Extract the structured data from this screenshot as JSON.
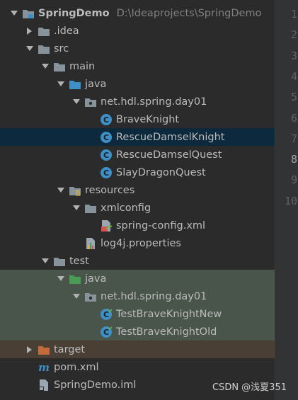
{
  "project": {
    "name": "SpringDemo",
    "path": "D:\\Ideaprojects\\SpringDemo"
  },
  "tree": [
    {
      "label": "SpringDemo",
      "icon": "project-folder-icon",
      "depth": 0,
      "expanded": true
    },
    {
      "label": ".idea",
      "icon": "folder-icon",
      "depth": 1,
      "expanded": false
    },
    {
      "label": "src",
      "icon": "folder-icon",
      "depth": 1,
      "expanded": true
    },
    {
      "label": "main",
      "icon": "folder-icon",
      "depth": 2,
      "expanded": true
    },
    {
      "label": "java",
      "icon": "source-root-folder-icon",
      "depth": 3,
      "expanded": true
    },
    {
      "label": "net.hdl.spring.day01",
      "icon": "package-icon",
      "depth": 4,
      "expanded": true
    },
    {
      "label": "BraveKnight",
      "icon": "class-icon",
      "depth": 5
    },
    {
      "label": "RescueDamselKnight",
      "icon": "class-icon",
      "depth": 5,
      "selected": true
    },
    {
      "label": "RescueDamselQuest",
      "icon": "class-icon",
      "depth": 5
    },
    {
      "label": "SlayDragonQuest",
      "icon": "class-icon",
      "depth": 5
    },
    {
      "label": "resources",
      "icon": "resources-folder-icon",
      "depth": 3,
      "expanded": true
    },
    {
      "label": "xmlconfig",
      "icon": "folder-icon",
      "depth": 4,
      "expanded": true
    },
    {
      "label": "spring-config.xml",
      "icon": "spring-xml-icon",
      "depth": 5
    },
    {
      "label": "log4j.properties",
      "icon": "properties-file-icon",
      "depth": 4
    },
    {
      "label": "test",
      "icon": "folder-icon",
      "depth": 2,
      "expanded": true
    },
    {
      "label": "java",
      "icon": "test-root-folder-icon",
      "depth": 3,
      "expanded": true,
      "test": true
    },
    {
      "label": "net.hdl.spring.day01",
      "icon": "package-icon",
      "depth": 4,
      "expanded": true,
      "test": true
    },
    {
      "label": "TestBraveKnightNew",
      "icon": "test-class-icon",
      "depth": 5,
      "test": true
    },
    {
      "label": "TestBraveKnightOld",
      "icon": "test-class-icon",
      "depth": 5,
      "test": true
    },
    {
      "label": "target",
      "icon": "excluded-folder-icon",
      "depth": 1,
      "expanded": false,
      "excluded": true
    },
    {
      "label": "pom.xml",
      "icon": "maven-icon",
      "depth": 1
    },
    {
      "label": "SpringDemo.iml",
      "icon": "iml-file-icon",
      "depth": 1
    }
  ],
  "gutter_lines": [
    "1",
    "2",
    "3",
    "4",
    "5",
    "6",
    "7",
    "8",
    "9",
    "10"
  ],
  "current_line": "8",
  "watermark": "CSDN @浅夏351",
  "colors": {
    "background": "#2b2b2b",
    "selected": "#0d293e",
    "test_bg": "#49544a",
    "excluded_bg": "#4a3f35",
    "text": "#bbbbbb",
    "folder": "#87939a",
    "source": "#3d8fc6",
    "test": "#499c54",
    "excluded": "#c46b3c",
    "class": "#3d8fc6"
  }
}
